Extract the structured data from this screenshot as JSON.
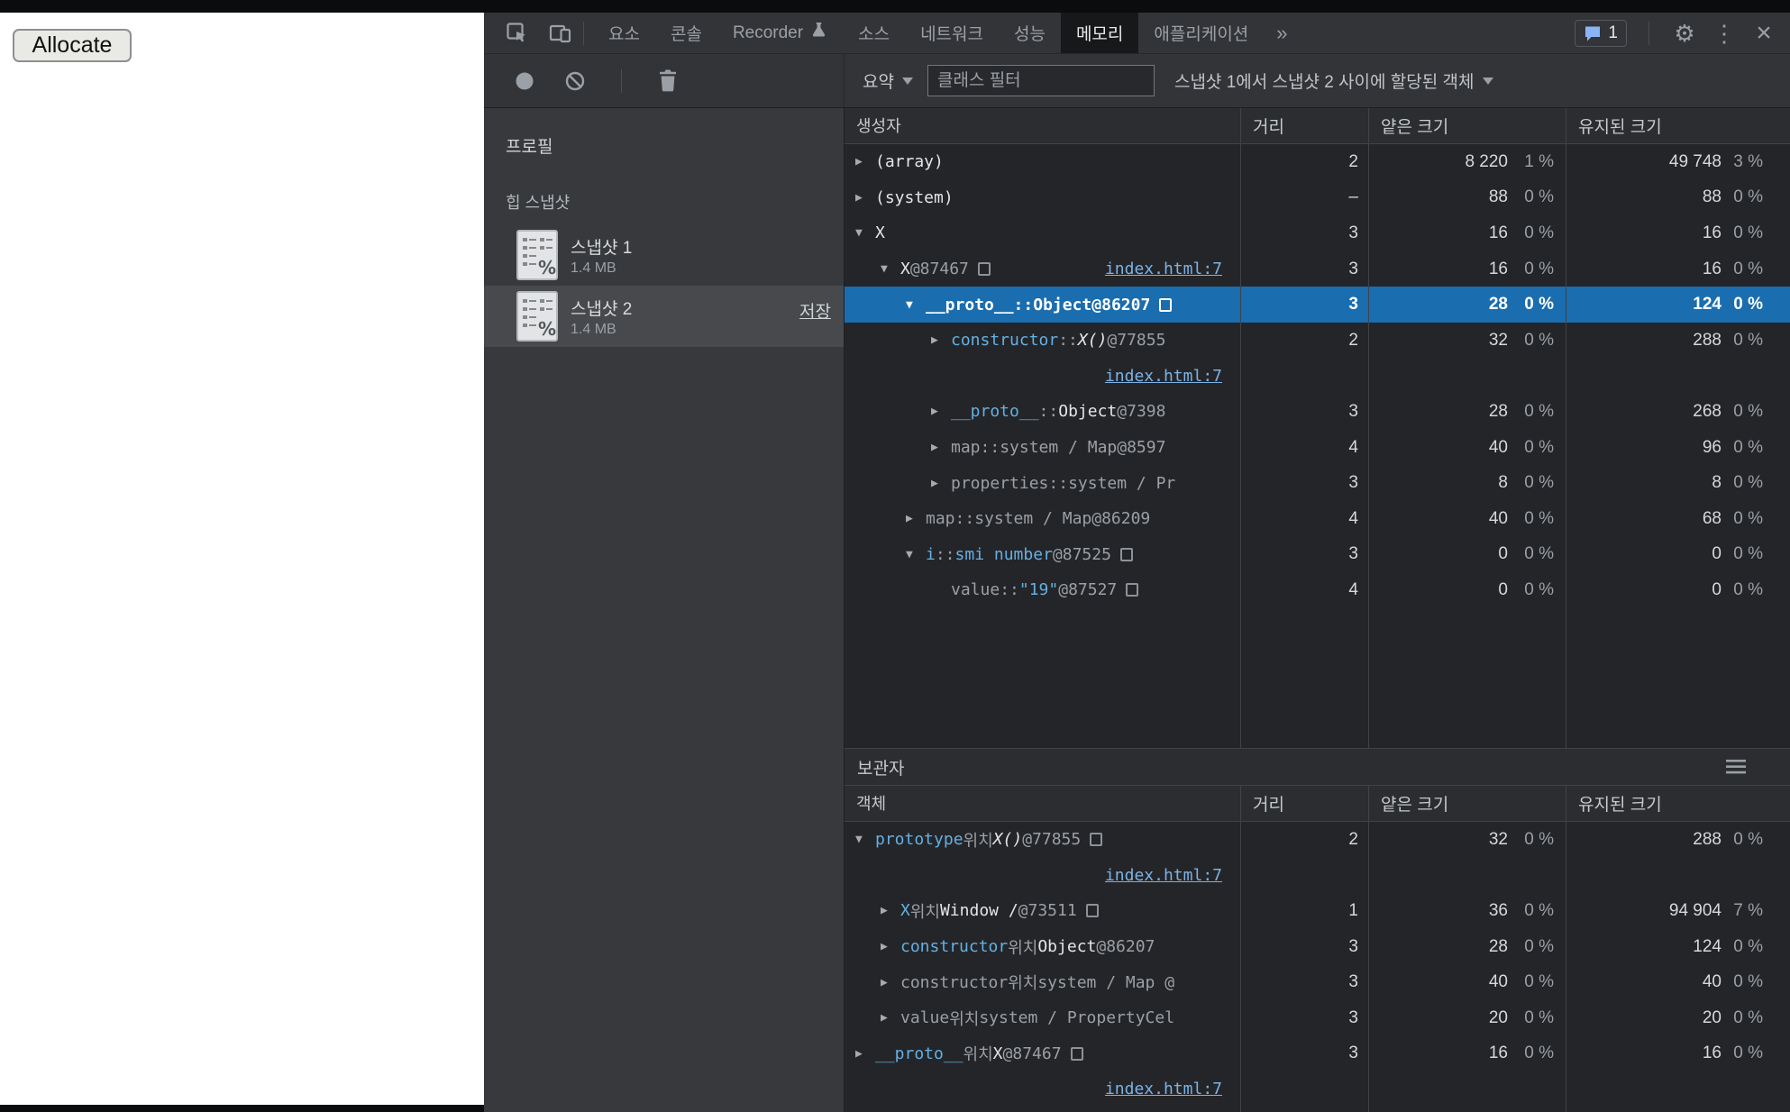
{
  "page": {
    "allocate_button": "Allocate"
  },
  "devtools": {
    "colors": {
      "selection": "#1a6dae",
      "link": "#7cb2e6",
      "property_name": "#64b0e4",
      "issues_icon": "#8ab4f8"
    },
    "tabbar": {
      "tabs": [
        {
          "label": "요소",
          "icon": null
        },
        {
          "label": "콘솔",
          "icon": null
        },
        {
          "label": "Recorder",
          "icon": "flask-icon"
        },
        {
          "label": "소스",
          "icon": null
        },
        {
          "label": "네트워크",
          "icon": null
        },
        {
          "label": "성능",
          "icon": null
        },
        {
          "label": "메모리",
          "icon": null
        },
        {
          "label": "애플리케이션",
          "icon": null
        }
      ],
      "active_tab": "메모리",
      "overflow_chevron": "»",
      "issues_count": "1"
    },
    "toolbar": {
      "summary_label": "요약",
      "class_filter_placeholder": "클래스 필터",
      "snapshot_range_label": "스냅샷 1에서 스냅샷 2 사이에 할당된 객체"
    },
    "sidebar": {
      "profiles_title": "프로필",
      "heap_section_title": "힙 스냅샷",
      "snapshots": [
        {
          "name": "스냅샷 1",
          "size": "1.4 MB",
          "selected": false,
          "save_label": null
        },
        {
          "name": "스냅샷 2",
          "size": "1.4 MB",
          "selected": true,
          "save_label": "저장"
        }
      ]
    },
    "constructors": {
      "columns": [
        "생성자",
        "거리",
        "얕은 크기",
        "유지된 크기"
      ],
      "rows": [
        {
          "indent": 0,
          "arrow": "closed",
          "parts": [
            [
              "(array)",
              "plain"
            ]
          ],
          "distance": "2",
          "shallow": "8 220",
          "shallow_pct": "1 %",
          "retained": "49 748",
          "retained_pct": "3 %"
        },
        {
          "indent": 0,
          "arrow": "closed",
          "parts": [
            [
              "(system)",
              "plain"
            ]
          ],
          "distance": "–",
          "shallow": "88",
          "shallow_pct": "0 %",
          "retained": "88",
          "retained_pct": "0 %"
        },
        {
          "indent": 0,
          "arrow": "open",
          "parts": [
            [
              "X",
              "plain"
            ]
          ],
          "distance": "3",
          "shallow": "16",
          "shallow_pct": "0 %",
          "retained": "16",
          "retained_pct": "0 %"
        },
        {
          "indent": 1,
          "arrow": "open",
          "parts": [
            [
              "X ",
              "plain"
            ],
            [
              "@87467",
              "dim"
            ],
            [
              "",
              "box"
            ]
          ],
          "inline_link": "index.html:7",
          "distance": "3",
          "shallow": "16",
          "shallow_pct": "0 %",
          "retained": "16",
          "retained_pct": "0 %"
        },
        {
          "indent": 2,
          "arrow": "open",
          "selected": true,
          "parts": [
            [
              "__proto__",
              "prop"
            ],
            [
              " :: ",
              "dim"
            ],
            [
              "Object",
              "plain"
            ],
            [
              " @86207",
              "dim"
            ],
            [
              "",
              "box"
            ]
          ],
          "distance": "3",
          "shallow": "28",
          "shallow_pct": "0 %",
          "retained": "124",
          "retained_pct": "0 %"
        },
        {
          "indent": 3,
          "arrow": "closed",
          "parts": [
            [
              "constructor",
              "prop"
            ],
            [
              " :: ",
              "dim"
            ],
            [
              "X()",
              "fn"
            ],
            [
              " @77855",
              "dim"
            ]
          ],
          "distance": "2",
          "shallow": "32",
          "shallow_pct": "0 %",
          "retained": "288",
          "retained_pct": "0 %"
        },
        {
          "link_row": "index.html:7"
        },
        {
          "indent": 3,
          "arrow": "closed",
          "parts": [
            [
              "__proto__",
              "prop"
            ],
            [
              " :: ",
              "dim"
            ],
            [
              "Object",
              "plain"
            ],
            [
              " @7398",
              "dim"
            ]
          ],
          "distance": "3",
          "shallow": "28",
          "shallow_pct": "0 %",
          "retained": "268",
          "retained_pct": "0 %"
        },
        {
          "indent": 3,
          "arrow": "closed",
          "parts": [
            [
              "map",
              "dim"
            ],
            [
              " :: ",
              "dim"
            ],
            [
              "system / Map",
              "dim"
            ],
            [
              " @8597",
              "dim"
            ]
          ],
          "distance": "4",
          "shallow": "40",
          "shallow_pct": "0 %",
          "retained": "96",
          "retained_pct": "0 %"
        },
        {
          "indent": 3,
          "arrow": "closed",
          "parts": [
            [
              "properties",
              "dim"
            ],
            [
              " :: ",
              "dim"
            ],
            [
              "system / Pr",
              "dim"
            ]
          ],
          "distance": "3",
          "shallow": "8",
          "shallow_pct": "0 %",
          "retained": "8",
          "retained_pct": "0 %"
        },
        {
          "indent": 2,
          "arrow": "closed",
          "parts": [
            [
              "map",
              "dim"
            ],
            [
              " :: ",
              "dim"
            ],
            [
              "system / Map",
              "dim"
            ],
            [
              " @86209",
              "dim"
            ]
          ],
          "distance": "4",
          "shallow": "40",
          "shallow_pct": "0 %",
          "retained": "68",
          "retained_pct": "0 %"
        },
        {
          "indent": 2,
          "arrow": "open",
          "parts": [
            [
              "i",
              "prop"
            ],
            [
              " :: ",
              "dim"
            ],
            [
              "smi number",
              "prop"
            ],
            [
              " @87525",
              "dim"
            ],
            [
              "",
              "box"
            ]
          ],
          "distance": "3",
          "shallow": "0",
          "shallow_pct": "0 %",
          "retained": "0",
          "retained_pct": "0 %"
        },
        {
          "indent": 3,
          "arrow": null,
          "parts": [
            [
              "value",
              "dim"
            ],
            [
              " :: ",
              "dim"
            ],
            [
              "\"19\"",
              "str"
            ],
            [
              " @87527",
              "dim"
            ],
            [
              "",
              "box"
            ]
          ],
          "distance": "4",
          "shallow": "0",
          "shallow_pct": "0 %",
          "retained": "0",
          "retained_pct": "0 %"
        }
      ]
    },
    "retainers": {
      "title": "보관자",
      "columns": [
        "객체",
        "거리",
        "얕은 크기",
        "유지된 크기"
      ],
      "rows": [
        {
          "indent": 0,
          "arrow": "open",
          "parts": [
            [
              "prototype",
              "prop"
            ],
            [
              " 위치 ",
              "dim"
            ],
            [
              "X()",
              "fn"
            ],
            [
              " @77855",
              "dim"
            ],
            [
              "",
              "box"
            ]
          ],
          "distance": "2",
          "shallow": "32",
          "shallow_pct": "0 %",
          "retained": "288",
          "retained_pct": "0 %"
        },
        {
          "link_row": "index.html:7"
        },
        {
          "indent": 1,
          "arrow": "closed",
          "parts": [
            [
              "X",
              "prop"
            ],
            [
              " 위치 ",
              "dim"
            ],
            [
              "Window /",
              "plain"
            ],
            [
              "  @73511",
              "dim"
            ],
            [
              "",
              "box"
            ]
          ],
          "distance": "1",
          "shallow": "36",
          "shallow_pct": "0 %",
          "retained": "94 904",
          "retained_pct": "7 %"
        },
        {
          "indent": 1,
          "arrow": "closed",
          "parts": [
            [
              "constructor",
              "prop"
            ],
            [
              " 위치 ",
              "dim"
            ],
            [
              "Object",
              "plain"
            ],
            [
              " @86207",
              "dim"
            ]
          ],
          "distance": "3",
          "shallow": "28",
          "shallow_pct": "0 %",
          "retained": "124",
          "retained_pct": "0 %"
        },
        {
          "indent": 1,
          "arrow": "closed",
          "parts": [
            [
              "constructor",
              "dim"
            ],
            [
              " 위치 ",
              "dim"
            ],
            [
              "system / Map @",
              "dim"
            ]
          ],
          "distance": "3",
          "shallow": "40",
          "shallow_pct": "0 %",
          "retained": "40",
          "retained_pct": "0 %"
        },
        {
          "indent": 1,
          "arrow": "closed",
          "parts": [
            [
              "value",
              "dim"
            ],
            [
              " 위치 ",
              "dim"
            ],
            [
              "system / PropertyCel",
              "dim"
            ]
          ],
          "distance": "3",
          "shallow": "20",
          "shallow_pct": "0 %",
          "retained": "20",
          "retained_pct": "0 %"
        },
        {
          "indent": 0,
          "arrow": "closed",
          "parts": [
            [
              "__proto__",
              "prop"
            ],
            [
              " 위치 ",
              "dim"
            ],
            [
              "X",
              "plain"
            ],
            [
              " @87467",
              "dim"
            ],
            [
              "",
              "box"
            ]
          ],
          "distance": "3",
          "shallow": "16",
          "shallow_pct": "0 %",
          "retained": "16",
          "retained_pct": "0 %"
        },
        {
          "link_row": "index.html:7"
        }
      ]
    }
  }
}
